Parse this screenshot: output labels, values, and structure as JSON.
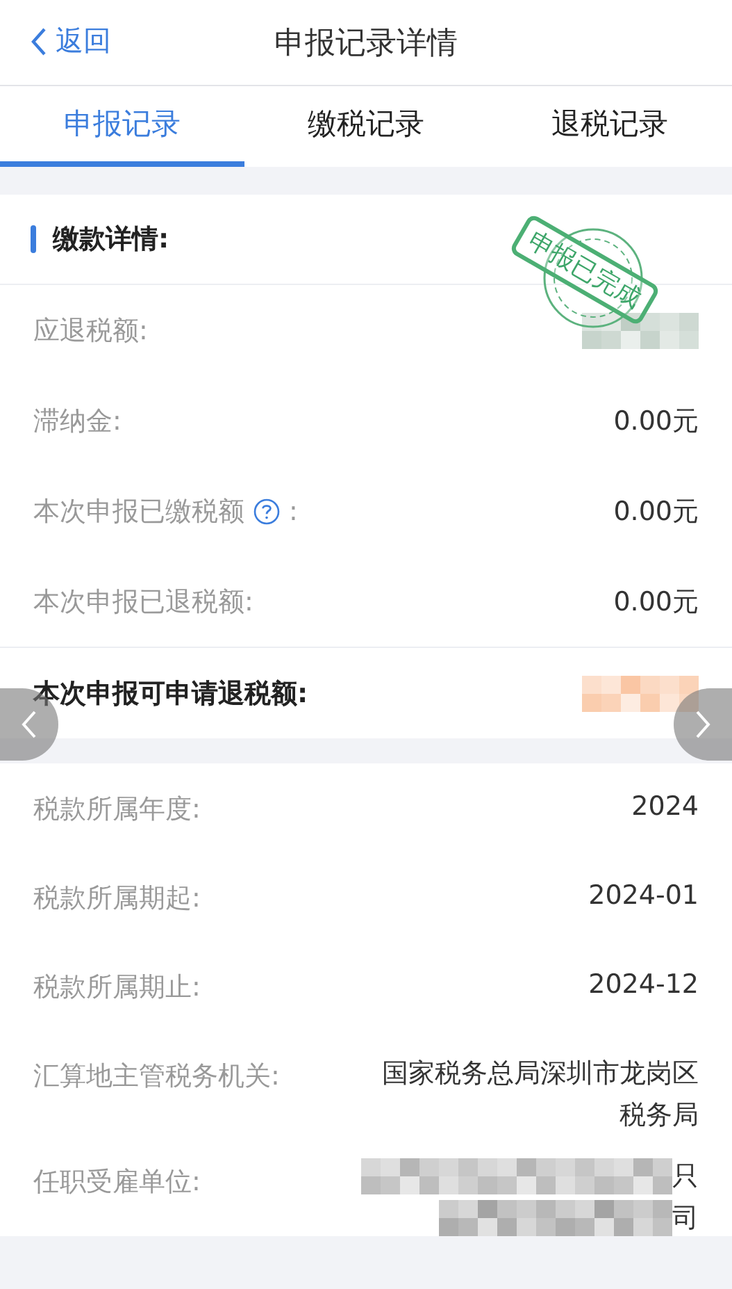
{
  "header": {
    "back": "返回",
    "title": "申报记录详情"
  },
  "tabs": [
    {
      "label": "申报记录",
      "selected": true
    },
    {
      "label": "缴税记录",
      "selected": false
    },
    {
      "label": "退税记录",
      "selected": false
    }
  ],
  "payment_section": {
    "title": "缴款详情:",
    "stamp": "申报已完成",
    "rows": [
      {
        "kind": "plain",
        "label": "应退税额:",
        "redacted": true,
        "color": "#b9c9bf"
      },
      {
        "kind": "plain",
        "label": "滞纳金:",
        "value": "0.00元"
      },
      {
        "kind": "plain",
        "label": "本次申报已缴税额",
        "help": true,
        "label_end": ":",
        "value": "0.00元"
      },
      {
        "kind": "plain",
        "label": "本次申报已退税额:",
        "value": "0.00元"
      },
      {
        "kind": "emphasis",
        "label": "本次申报可申请退税额:",
        "redacted": true,
        "color": "#f9c09a"
      }
    ]
  },
  "period_section": {
    "rows": [
      {
        "label": "税款所属年度:",
        "value": "2024"
      },
      {
        "label": "税款所属期起:",
        "value": "2024-01"
      },
      {
        "label": "税款所属期止:",
        "value": "2024-12"
      },
      {
        "label": "汇算地主管税务机关:",
        "value": "国家税务总局深圳市龙岗区税务局"
      },
      {
        "label": "任职受雇单位:",
        "redacted_lines": [
          {
            "tail": "只"
          },
          {
            "tail": "司"
          }
        ]
      }
    ]
  }
}
